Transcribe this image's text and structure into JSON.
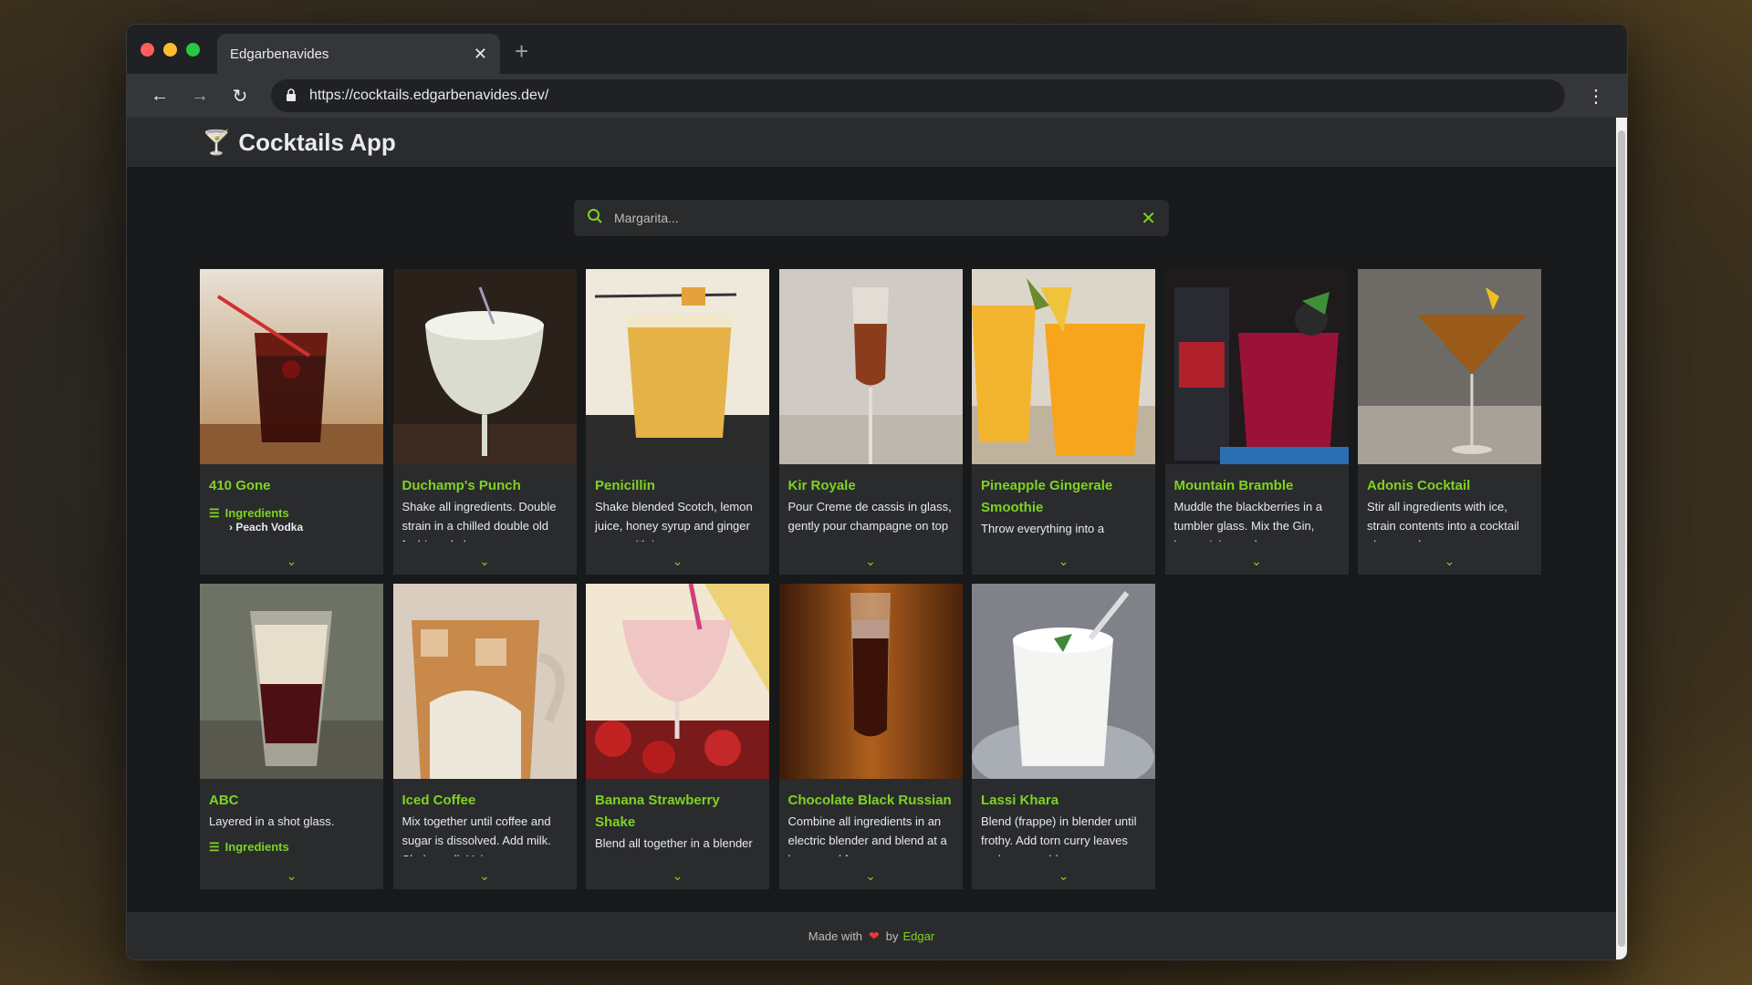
{
  "browser": {
    "tab_title": "Edgarbenavides",
    "url": "https://cocktails.edgarbenavides.dev/"
  },
  "app": {
    "title": "Cocktails App",
    "logo_icon": "🍸"
  },
  "search": {
    "placeholder": "Margarita..."
  },
  "cards": [
    {
      "title": "410 Gone",
      "text": "",
      "ingredients_label": "Ingredients",
      "first_ingredient": "Peach Vodka"
    },
    {
      "title": "Duchamp's Punch",
      "text": "Shake all ingredients. Double strain in a chilled double old fashioned glass",
      "ingredients_label": "",
      "first_ingredient": ""
    },
    {
      "title": "Penicillin",
      "text": "Shake blended Scotch, lemon juice, honey syrup and ginger syrup with ice",
      "ingredients_label": "",
      "first_ingredient": ""
    },
    {
      "title": "Kir Royale",
      "text": "Pour Creme de cassis in glass, gently pour champagne on top",
      "ingredients_label": "",
      "first_ingredient": ""
    },
    {
      "title": "Pineapple Gingerale Smoothie",
      "text": "Throw everything into a blender and liquify",
      "ingredients_label": "",
      "first_ingredient": ""
    },
    {
      "title": "Mountain Bramble",
      "text": "Muddle the blackberries in a tumbler glass. Mix the Gin, lemon juice and sugar syrup",
      "ingredients_label": "",
      "first_ingredient": ""
    },
    {
      "title": "Adonis Cocktail",
      "text": "Stir all ingredients with ice, strain contents into a cocktail glass, and serve",
      "ingredients_label": "",
      "first_ingredient": ""
    },
    {
      "title": "ABC",
      "text": "Layered in a shot glass.",
      "ingredients_label": "Ingredients",
      "first_ingredient": ""
    },
    {
      "title": "Iced Coffee",
      "text": "Mix together until coffee and sugar is dissolved. Add milk. Shake well. Using a",
      "ingredients_label": "",
      "first_ingredient": ""
    },
    {
      "title": "Banana Strawberry Shake",
      "text": "Blend all together in a blender until smooth",
      "ingredients_label": "",
      "first_ingredient": ""
    },
    {
      "title": "Chocolate Black Russian",
      "text": "Combine all ingredients in an electric blender and blend at a low speed for a",
      "ingredients_label": "",
      "first_ingredient": ""
    },
    {
      "title": "Lassi Khara",
      "text": "Blend (frappe) in blender until frothy. Add torn curry leaves and serve cold",
      "ingredients_label": "",
      "first_ingredient": ""
    }
  ],
  "footer": {
    "made_with": "Made with",
    "by": "by",
    "author": "Edgar"
  },
  "colors": {
    "accent": "#7ed321",
    "background": "#18191b",
    "card": "#2a2b2d"
  }
}
